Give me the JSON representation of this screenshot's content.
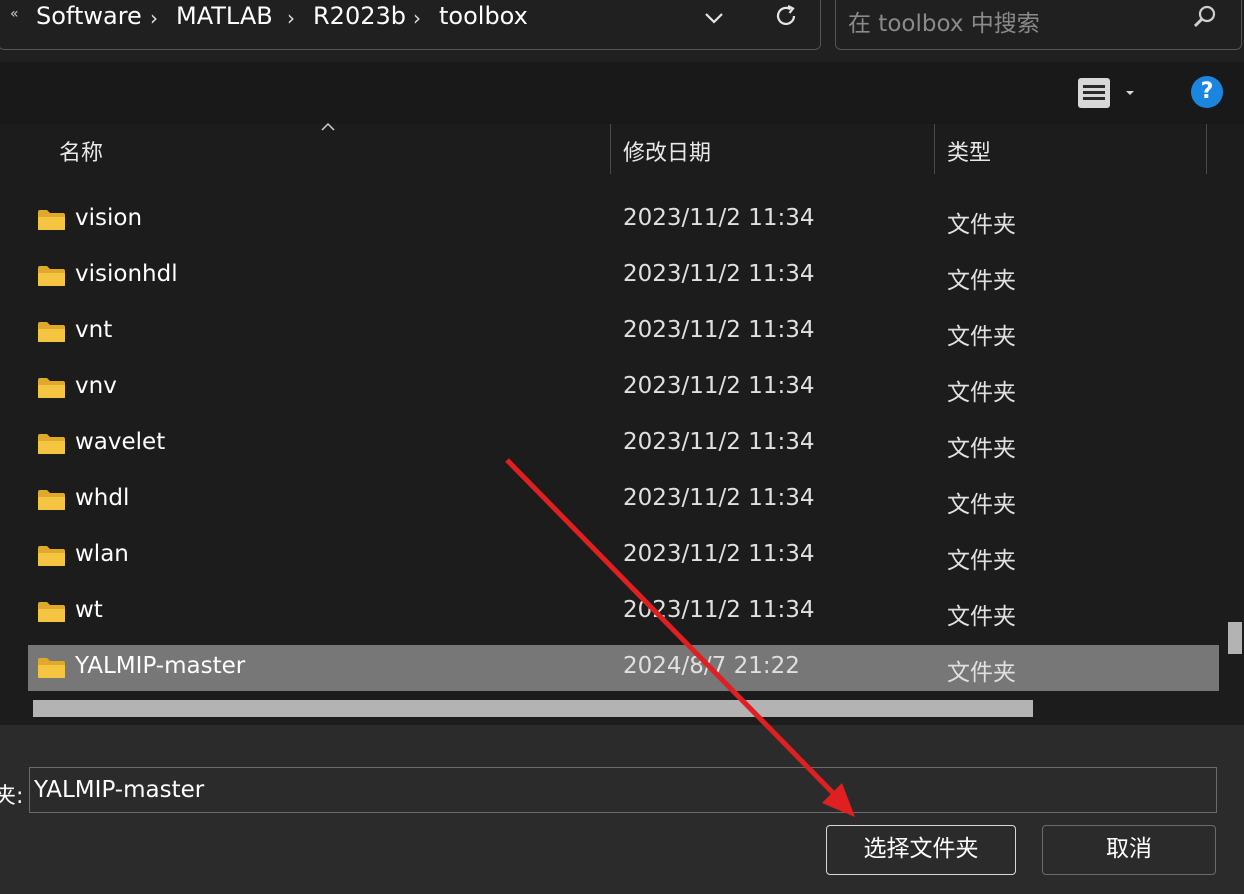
{
  "breadcrumb": {
    "overflow": "«",
    "items": [
      "Software",
      "MATLAB",
      "R2023b",
      "toolbox"
    ],
    "separator": "›"
  },
  "search": {
    "placeholder": "在 toolbox 中搜索"
  },
  "help_label": "?",
  "columns": {
    "name": "名称",
    "modified": "修改日期",
    "type": "类型"
  },
  "files": [
    {
      "name": "vision",
      "modified": "2023/11/2 11:34",
      "type": "文件夹"
    },
    {
      "name": "visionhdl",
      "modified": "2023/11/2 11:34",
      "type": "文件夹"
    },
    {
      "name": "vnt",
      "modified": "2023/11/2 11:34",
      "type": "文件夹"
    },
    {
      "name": "vnv",
      "modified": "2023/11/2 11:34",
      "type": "文件夹"
    },
    {
      "name": "wavelet",
      "modified": "2023/11/2 11:34",
      "type": "文件夹"
    },
    {
      "name": "whdl",
      "modified": "2023/11/2 11:34",
      "type": "文件夹"
    },
    {
      "name": "wlan",
      "modified": "2023/11/2 11:34",
      "type": "文件夹"
    },
    {
      "name": "wt",
      "modified": "2023/11/2 11:34",
      "type": "文件夹"
    },
    {
      "name": "YALMIP-master",
      "modified": "2024/8/7 21:22",
      "type": "文件夹",
      "selected": true
    }
  ],
  "folder_field": {
    "label": "夹:",
    "value": "YALMIP-master"
  },
  "buttons": {
    "select": "选择文件夹",
    "cancel": "取消"
  },
  "colors": {
    "folder": "#f5c542",
    "accent": "#1a86e0",
    "arrow": "#e02020",
    "selection": "#777777"
  },
  "icons": [
    "chevron-down-icon",
    "refresh-icon",
    "search-icon",
    "view-list-icon",
    "help-icon",
    "folder-icon",
    "sort-up-icon"
  ]
}
